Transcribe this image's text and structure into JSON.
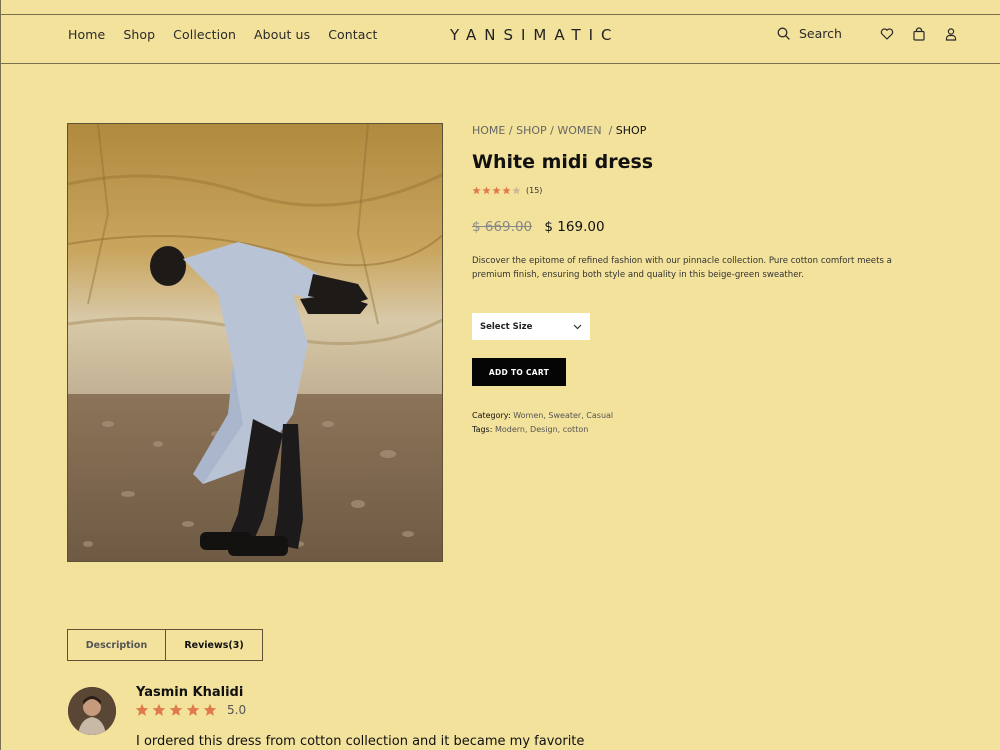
{
  "nav": {
    "items": [
      "Home",
      "Shop",
      "Collection",
      "About us",
      "Contact"
    ]
  },
  "brand": {
    "logo": "YANSIMATIC"
  },
  "header": {
    "search_label": "Search",
    "icons": [
      "search-icon",
      "heart-icon",
      "bag-icon",
      "user-icon"
    ]
  },
  "product": {
    "image_alt": "Model in white midi dress",
    "breadcrumb": [
      "HOME",
      "SHOP",
      "WOMEN",
      "SHOP"
    ],
    "breadcrumb_sep": "/",
    "title": "White midi dress",
    "rating": {
      "stars": 4,
      "out_of": 5,
      "count": "(15)"
    },
    "old_price": "$ 669.00",
    "new_price": "$ 169.00",
    "description": "Discover the epitome of refined fashion with our pinnacle collection. Pure cotton comfort meets a premium finish, ensuring both style and quality in this beige-green sweather.",
    "size_select_label": "Select Size",
    "add_to_cart": "ADD TO CART",
    "category_label": "Category:",
    "category_value": "Women, Sweater, Casual",
    "tags_label": "Tags:",
    "tags_value": "Modern, Design, cotton"
  },
  "tabs": [
    {
      "label": "Description",
      "active": false
    },
    {
      "label": "Reviews(3)",
      "active": true
    }
  ],
  "review": {
    "name": "Yasmin Khalidi",
    "stars": 5,
    "score": "5.0",
    "text": "I ordered this dress from cotton collection and it became my favorite"
  },
  "colors": {
    "background": "#f3e29c",
    "star": "#e07a4a",
    "button": "#050505"
  }
}
